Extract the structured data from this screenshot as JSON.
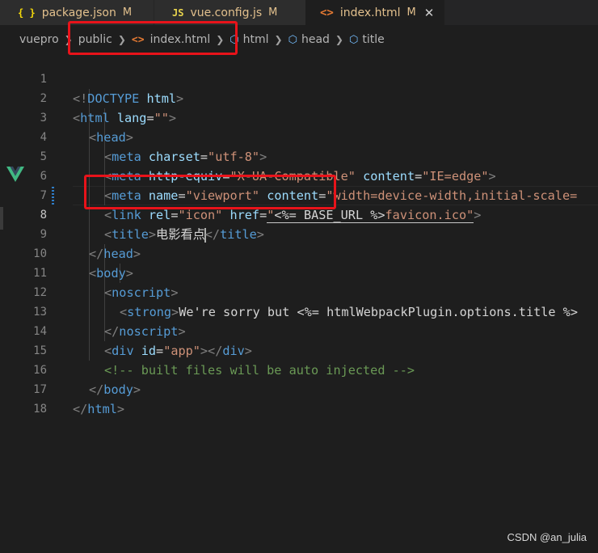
{
  "tabs": [
    {
      "icon": "{ }",
      "name": "package.json",
      "status": "M",
      "active": false
    },
    {
      "icon": "JS",
      "name": "vue.config.js",
      "status": "M",
      "active": false
    },
    {
      "icon": "<>",
      "name": "index.html",
      "status": "M",
      "active": true,
      "close": "✕"
    }
  ],
  "breadcrumb": {
    "root": "vuepro",
    "folder": "public",
    "file_icon": "<>",
    "file": "index.html",
    "symbols": [
      "html",
      "head",
      "title"
    ]
  },
  "code": {
    "current_line": 8,
    "lines": [
      {
        "n": "1"
      },
      {
        "n": "2"
      },
      {
        "n": "3"
      },
      {
        "n": "4"
      },
      {
        "n": "5"
      },
      {
        "n": "6"
      },
      {
        "n": "7"
      },
      {
        "n": "8"
      },
      {
        "n": "9"
      },
      {
        "n": "10"
      },
      {
        "n": "11"
      },
      {
        "n": "12"
      },
      {
        "n": "13"
      },
      {
        "n": "14"
      },
      {
        "n": "15"
      },
      {
        "n": "16"
      },
      {
        "n": "17"
      },
      {
        "n": "18"
      }
    ],
    "l1": {
      "open": "<!",
      "doctype": "DOCTYPE",
      "html": " html",
      "close": ">"
    },
    "l2": {
      "open": "<",
      "tag": "html",
      "attr": " lang",
      "eq": "=",
      "val": "\"\"",
      "close": ">"
    },
    "l3": {
      "open": "<",
      "tag": "head",
      "close": ">"
    },
    "l4": {
      "open": "<",
      "tag": "meta",
      "attr": " charset",
      "eq": "=",
      "val": "\"utf-8\"",
      "close": ">"
    },
    "l5": {
      "open": "<",
      "tag": "meta",
      "attr1": " http-equiv",
      "eq": "=",
      "val1": "\"X-UA-Compatible\"",
      "attr2": " content",
      "val2": "\"IE=edge\"",
      "close": ">"
    },
    "l6": {
      "open": "<",
      "tag": "meta",
      "attr1": " name",
      "eq": "=",
      "val1": "\"viewport\"",
      "attr2": " content",
      "val2": "\"width=device-width,initial-scale="
    },
    "l7": {
      "open": "<",
      "tag": "link",
      "attr1": " rel",
      "eq": "=",
      "val1": "\"icon\"",
      "attr2": " href",
      "val2a": "\"",
      "tmpl": "<%= BASE_URL %>",
      "val2b": "favicon.ico\"",
      "close": ">"
    },
    "l8": {
      "open": "<",
      "tag": "title",
      "close": ">",
      "text": "电影看点",
      "close_open": "</",
      "close_tag": "title",
      "close_close": ">"
    },
    "l9": {
      "open": "</",
      "tag": "head",
      "close": ">"
    },
    "l10": {
      "open": "<",
      "tag": "body",
      "close": ">"
    },
    "l11": {
      "open": "<",
      "tag": "noscript",
      "close": ">"
    },
    "l12": {
      "open": "<",
      "tag": "strong",
      "close": ">",
      "text": "We're sorry but ",
      "tmpl": "<%= htmlWebpackPlugin.options.title %>"
    },
    "l13": {
      "open": "</",
      "tag": "noscript",
      "close": ">"
    },
    "l14": {
      "open": "<",
      "tag": "div",
      "attr": " id",
      "eq": "=",
      "val": "\"app\"",
      "mid": "></",
      "tag2": "div",
      "close": ">"
    },
    "l15": {
      "comment": "<!-- built files will be auto injected -->"
    },
    "l16": {
      "open": "</",
      "tag": "body",
      "close": ">"
    },
    "l17": {
      "open": "</",
      "tag": "html",
      "close": ">"
    }
  },
  "watermark": "CSDN @an_julia",
  "colors": {
    "tag": "#569cd6",
    "attribute": "#9cdcfe",
    "string": "#ce9178",
    "comment": "#6a9955",
    "annotation_red": "#e8131a",
    "modified_tab": "#e2c08d"
  },
  "icons": [
    "json-braces-icon",
    "javascript-icon",
    "html-file-icon",
    "close-icon",
    "chevron-right-icon",
    "symbol-cube-icon",
    "vue-logo-icon"
  ]
}
